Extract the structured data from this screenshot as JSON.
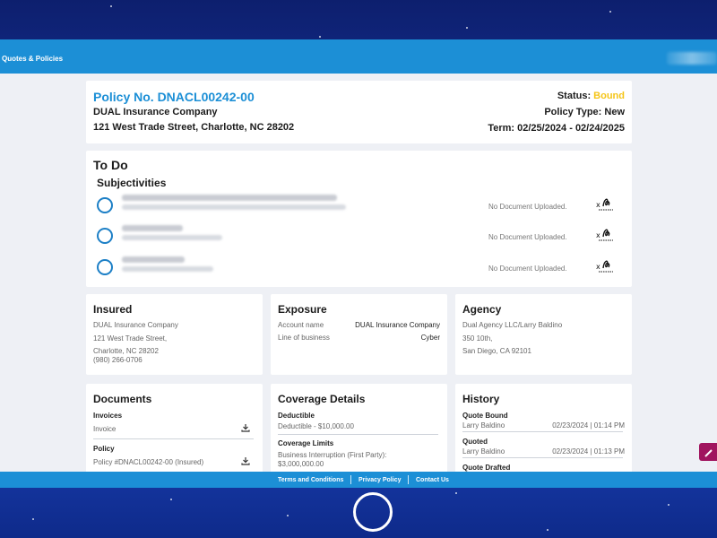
{
  "nav": {
    "label": "Quotes & Policies"
  },
  "policy": {
    "number": "Policy No. DNACL00242-00",
    "company": "DUAL Insurance Company",
    "address": "121 West Trade Street, Charlotte, NC 28202",
    "status_label": "Status: ",
    "status_value": "Bound",
    "type": "Policy Type: New",
    "term": "Term: 02/25/2024 - 02/24/2025"
  },
  "todo": {
    "title": "To Do",
    "subtitle": "Subjectivities",
    "items": [
      {
        "status": "No Document Uploaded."
      },
      {
        "status": "No Document Uploaded."
      },
      {
        "status": "No Document Uploaded."
      }
    ]
  },
  "insured": {
    "title": "Insured",
    "name": "DUAL Insurance Company",
    "street": "121 West Trade Street,",
    "city": "Charlotte, NC 28202",
    "phone": "(980) 266-0706"
  },
  "exposure": {
    "title": "Exposure",
    "account_label": "Account name",
    "account_value": "DUAL Insurance Company",
    "lob_label": "Line of business",
    "lob_value": "Cyber"
  },
  "agency": {
    "title": "Agency",
    "name": "Dual Agency LLC/Larry Baldino",
    "street": "350 10th,",
    "city": "San Diego, CA 92101"
  },
  "documents": {
    "title": "Documents",
    "invoices_heading": "Invoices",
    "invoice_item": "Invoice",
    "policy_heading": "Policy",
    "policy_item": "Policy #DNACL00242-00 (Insured)"
  },
  "coverage": {
    "title": "Coverage Details",
    "deductible_heading": "Deductible",
    "deductible_value": "Deductible - $10,000.00",
    "limits_heading": "Coverage Limits",
    "limits_line1": "Business Interruption (First Party):",
    "limits_line2": "$3,000,000.00"
  },
  "history": {
    "title": "History",
    "entries": [
      {
        "event": "Quote Bound",
        "user": "Larry Baldino",
        "time": "02/23/2024 | 01:14 PM"
      },
      {
        "event": "Quoted",
        "user": "Larry Baldino",
        "time": "02/23/2024 | 01:13 PM"
      },
      {
        "event": "Quote Drafted"
      }
    ]
  },
  "footer": {
    "terms": "Terms and Conditions",
    "privacy": "Privacy Policy",
    "contact": "Contact Us"
  },
  "colors": {
    "accent": "#1c8fd6",
    "status_bound": "#f5c518",
    "edit_button": "#a0145e"
  }
}
